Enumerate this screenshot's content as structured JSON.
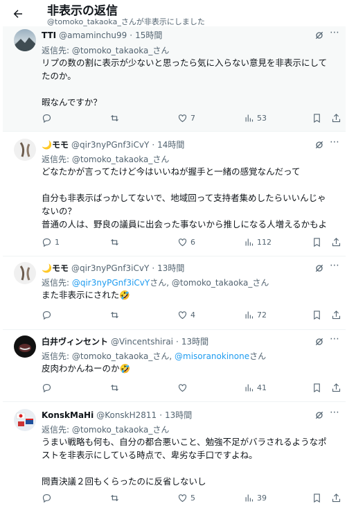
{
  "header": {
    "title": "非表示の返信",
    "subtitle": "@tomoko_takaoka_さんが非表示にしました"
  },
  "tweets": [
    {
      "name": "TTI",
      "handle": "@amaminchu99",
      "sep": "·",
      "time": "15時間",
      "reply_prefix": "返信先: ",
      "reply_to": "@tomoko_takaoka_さん",
      "text": "リプの数の割に表示が少ないと思ったら気に入らない意見を非表示にしてたのか。\n\n暇なんですか？",
      "replies": "",
      "retweets": "",
      "likes": "7",
      "views": "53"
    },
    {
      "name": "🌙モモ",
      "handle": "@qir3nyPGnf3iCvY",
      "sep": "·",
      "time": "14時間",
      "reply_prefix": "返信先: ",
      "reply_to": "@tomoko_takaoka_さん",
      "text": "どなたかが言ってたけど今はいいねが握手と一緒の感覚なんだって\n\n自分も非表示ばっかしてないで、地域回って支持者集めしたらいいんじゃないの？\n普通の人は、野良の議員に出会った事ないから推しになる人増えるかもよ",
      "replies": "1",
      "retweets": "",
      "likes": "6",
      "views": "112"
    },
    {
      "name": "🌙モモ",
      "handle": "@qir3nyPGnf3iCvY",
      "sep": "·",
      "time": "13時間",
      "reply_prefix": "返信先: ",
      "reply_to_link": "@qir3nyPGnf3iCvY",
      "reply_to_mid": "さん, ",
      "reply_to": "@tomoko_takaoka_さん",
      "text": "また非表示にされた🤣",
      "replies": "",
      "retweets": "",
      "likes": "4",
      "views": "72"
    },
    {
      "name": "白井ヴィンセント",
      "handle": "@Vincentshirai",
      "sep": "·",
      "time": "13時間",
      "reply_prefix": "返信先: ",
      "reply_to": "@tomoko_takaoka_さん, ",
      "reply_to_link": "@misoranokinone",
      "reply_to_end": "さん",
      "text": "皮肉わかんねーのか🤣",
      "replies": "",
      "retweets": "",
      "likes": "",
      "views": "41"
    },
    {
      "name": "KonskMaHi",
      "handle": "@KonskH2811",
      "sep": "·",
      "time": "13時間",
      "reply_prefix": "返信先: ",
      "reply_to": "@tomoko_takaoka_さん",
      "text": "うまい戦略も何も、自分の都合悪いこと、勉強不足がバラされるようなポストを非表示にしている時点で、卑劣な手口ですよね。\n\n問責決議２回もくらったのに反省しないし",
      "replies": "",
      "retweets": "",
      "likes": "5",
      "views": "39"
    }
  ],
  "icons": {
    "back": "arrow-left-icon",
    "grok": "grok-icon",
    "more": "more-icon",
    "reply": "reply-icon",
    "retweet": "retweet-icon",
    "like": "heart-icon",
    "views": "views-icon",
    "bookmark": "bookmark-icon",
    "share": "share-icon"
  },
  "colors": {
    "link": "#1d9bf0",
    "muted": "#536471",
    "text": "#0f1419",
    "highlight_bg": "#f7f9f9"
  }
}
